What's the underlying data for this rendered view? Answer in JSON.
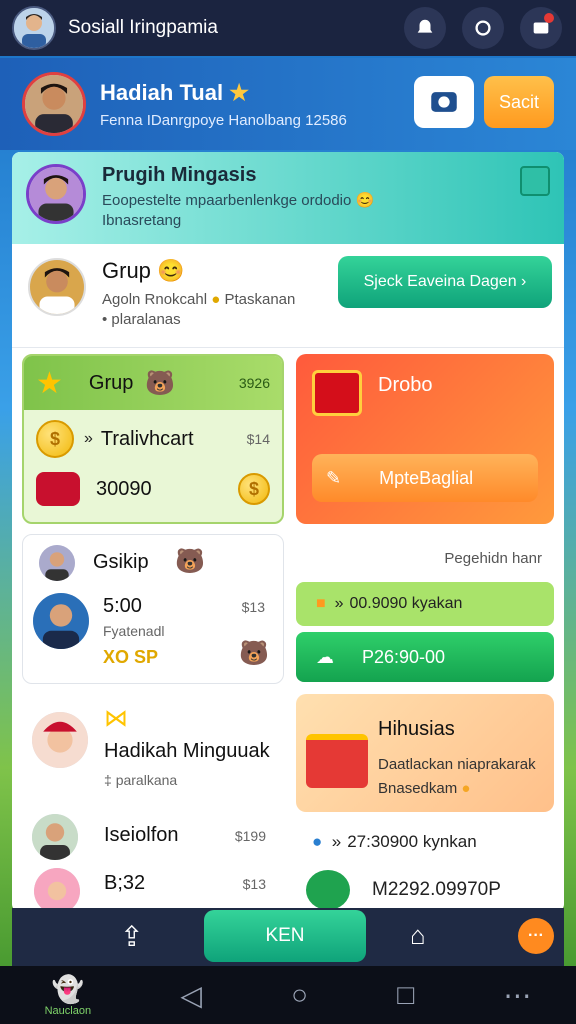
{
  "topbar": {
    "title": "Sosiall Iringpamia"
  },
  "profile": {
    "name": "Hadiah Tual",
    "subtitle": "Fenna IDanrgpoye Hanolbang 12586",
    "save_label": "Sacit"
  },
  "featured": {
    "title": "Prugih Mingasis",
    "subtitle_line1": "Eoopestelte mpaarbenlenkge ordodio",
    "subtitle_line2": "Ibnasretang"
  },
  "group": {
    "title": "Grup",
    "subtitle_line1": "Agoln Rnokcahl",
    "subtitle_line1b": "Ptaskanan",
    "subtitle_line2": "plaralanas",
    "button_label": "Sjeck Eaveina Dagen"
  },
  "grup_card": {
    "title": "Grup",
    "count": "3926",
    "row1_label": "Tralivhcart",
    "row1_amount": "$14",
    "row2_label": "30090"
  },
  "drobo_card": {
    "title": "Drobo",
    "button_label": "MpteBaglial"
  },
  "gskip_card": {
    "title": "Gsikip",
    "time": "5:00",
    "amount": "$13",
    "sub": "Fyatenadl",
    "tag": "XO SP"
  },
  "right_mid": {
    "heading": "Pegehidn hanr",
    "row1": "00.9090 kyakan",
    "row2": "P26:90-00"
  },
  "hadikah": {
    "title": "Hadikah Minguuak",
    "sub": "paralkana"
  },
  "hihusias": {
    "title": "Hihusias",
    "line1": "Daatlackan niaprakarak",
    "line2": "Bnasedkam"
  },
  "list": {
    "row1_label": "Iseiolfon",
    "row1_amount": "$199",
    "row2_label": "B;32",
    "row2_amount": "$13",
    "right1": "27:30900 kynkan",
    "right2": "M2292.09970P"
  },
  "bottombar": {
    "center_label": "KEN"
  },
  "nav": {
    "home_label": "Nauclaon"
  },
  "colors": {
    "brand_green": "#0fa37a",
    "accent_orange": "#ffa726",
    "topbar": "#1b2440"
  }
}
